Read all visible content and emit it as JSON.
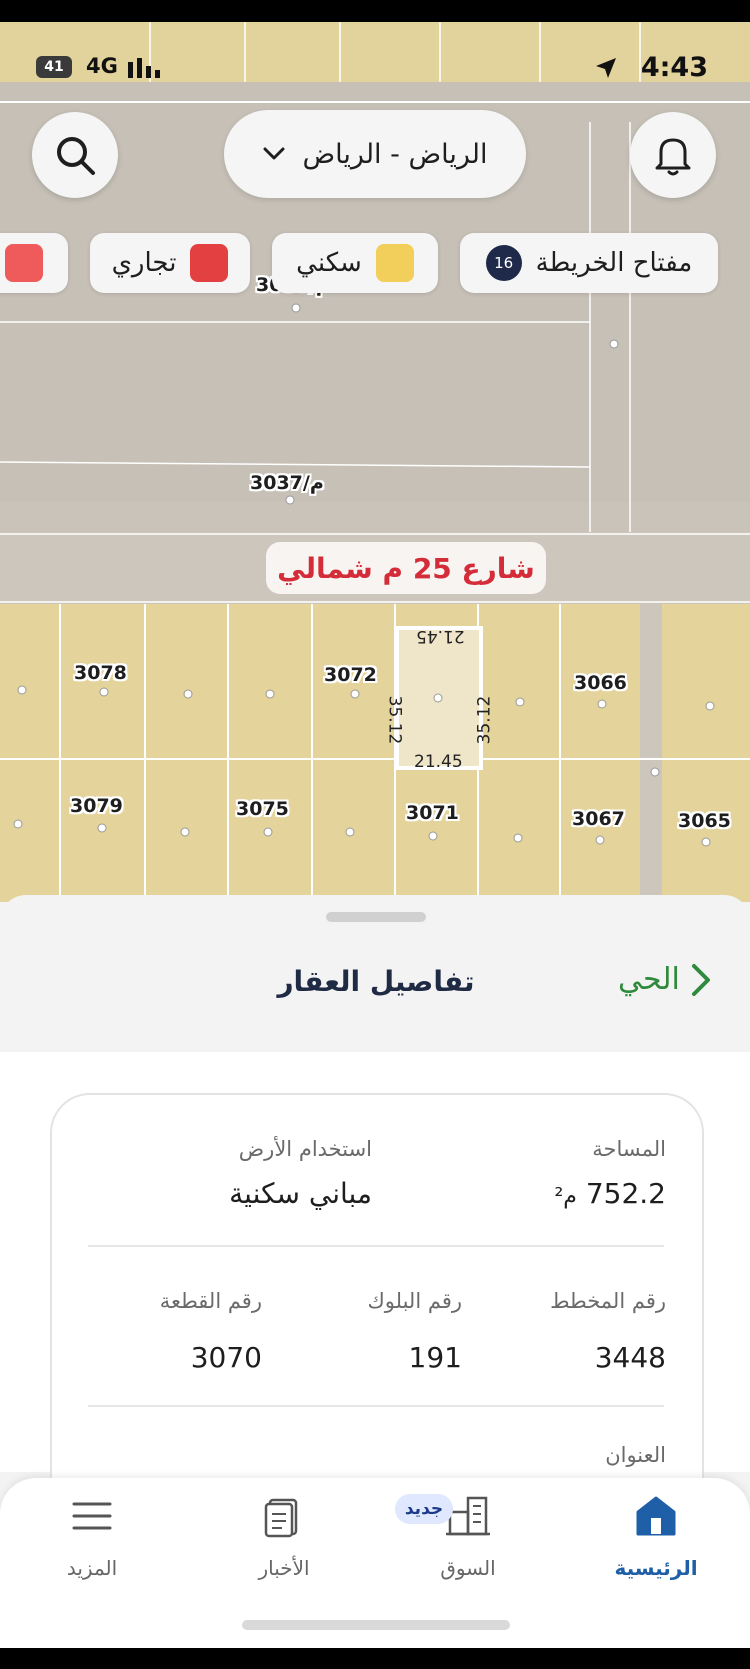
{
  "status": {
    "battery": "41",
    "network": "4G",
    "time": "4:43"
  },
  "header": {
    "city": "الرياض - الرياض"
  },
  "map_key": {
    "label": "مفتاح الخريطة",
    "count": "16",
    "chips": [
      {
        "label": "سكني",
        "color": "#f2cf5a"
      },
      {
        "label": "تجاري",
        "color": "#e34141"
      },
      {
        "label": "",
        "color": "#ef5a5a"
      }
    ]
  },
  "map": {
    "street": "شارع 25 م شمالي",
    "north_labels": [
      "3036/م",
      "3037/م"
    ],
    "parcels_top": [
      "3078",
      "3072",
      "3066"
    ],
    "parcels_bottom": [
      "3079",
      "3075",
      "3071",
      "3067",
      "3065"
    ],
    "selected_dims": {
      "top": "21.45",
      "bottom": "21.45",
      "left": "35.12",
      "right": "35.12"
    },
    "colors": {
      "residential": "#e6d59d",
      "road": "#c9c3b9",
      "selected": "#efe6c9"
    }
  },
  "sheet": {
    "title": "تفاصيل العقار",
    "back": "الحي"
  },
  "details": {
    "area_label": "المساحة",
    "area_value": "752.2",
    "area_unit": "م²",
    "land_use_label": "استخدام الأرض",
    "land_use_value": "مباني سكنية",
    "plan_label": "رقم المخطط",
    "plan_value": "3448",
    "block_label": "رقم البلوك",
    "block_value": "191",
    "plot_label": "رقم القطعة",
    "plot_value": "3070",
    "address_label": "العنوان"
  },
  "tabs": [
    {
      "label": "الرئيسية",
      "icon": "home-icon",
      "active": true
    },
    {
      "label": "السوق",
      "icon": "building-icon",
      "badge": "جديد"
    },
    {
      "label": "الأخبار",
      "icon": "news-icon"
    },
    {
      "label": "المزيد",
      "icon": "menu-icon"
    }
  ]
}
